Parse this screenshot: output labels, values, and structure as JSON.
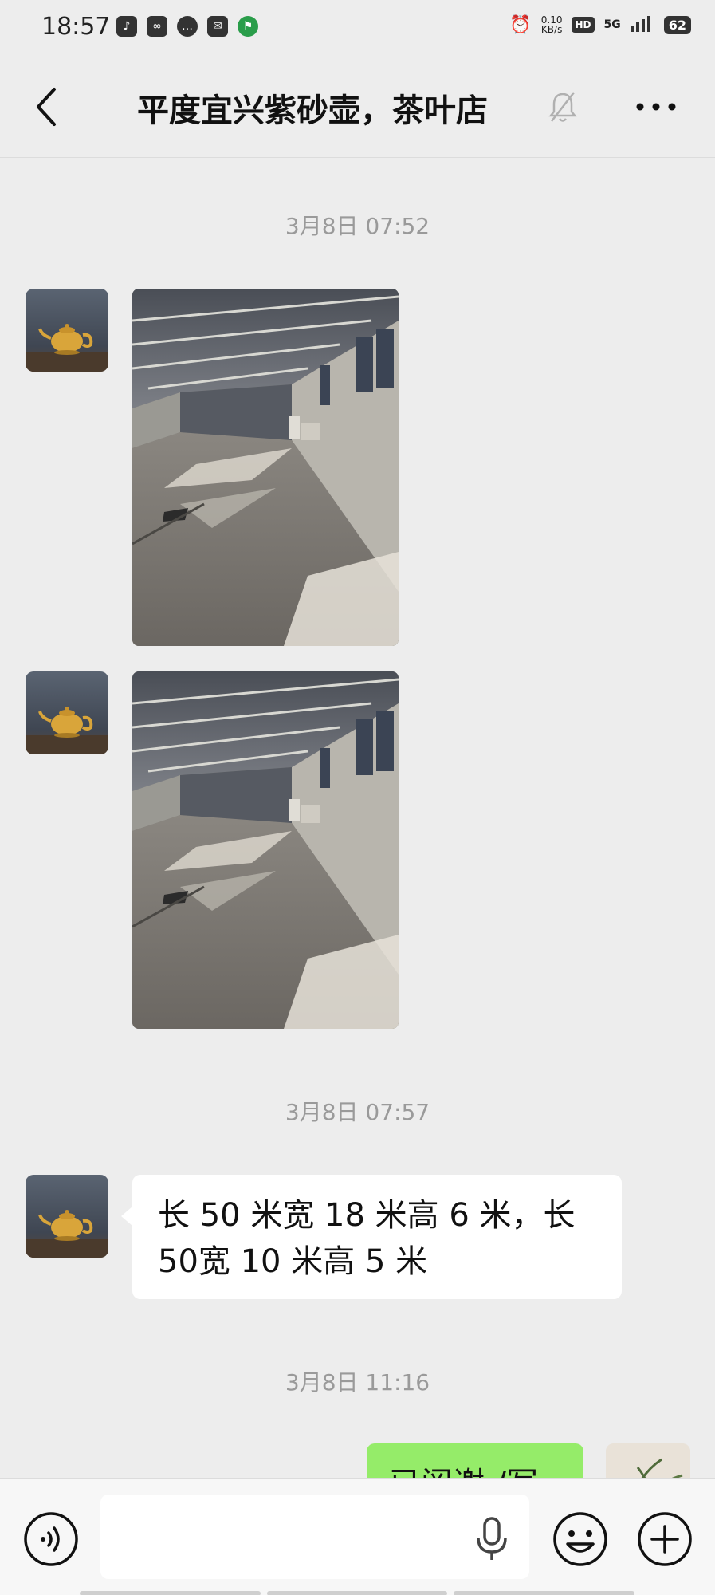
{
  "status_bar": {
    "time": "18:57",
    "net_speed_value": "0.10",
    "net_speed_unit": "KB/s",
    "hd_badge": "HD",
    "network": "5G",
    "battery": "62"
  },
  "header": {
    "title": "平度宜兴紫砂壶，茶叶店"
  },
  "chat": {
    "timestamps": [
      "3月8日 07:52",
      "3月8日 07:57",
      "3月8日 11:16"
    ],
    "text_message_line1": "长 50 米宽 18 米高 6 米，长",
    "text_message_line2": "50宽 10 米高 5 米",
    "my_message_partial": "已阅谢:/写"
  },
  "colors": {
    "background": "#ededed",
    "my_bubble": "#95ec69",
    "other_bubble": "#ffffff",
    "timestamp_text": "#9a9a9a"
  },
  "icons": [
    "back-icon",
    "mute-bell-icon",
    "more-icon",
    "voice-icon",
    "microphone-icon",
    "emoji-icon",
    "plus-icon"
  ]
}
